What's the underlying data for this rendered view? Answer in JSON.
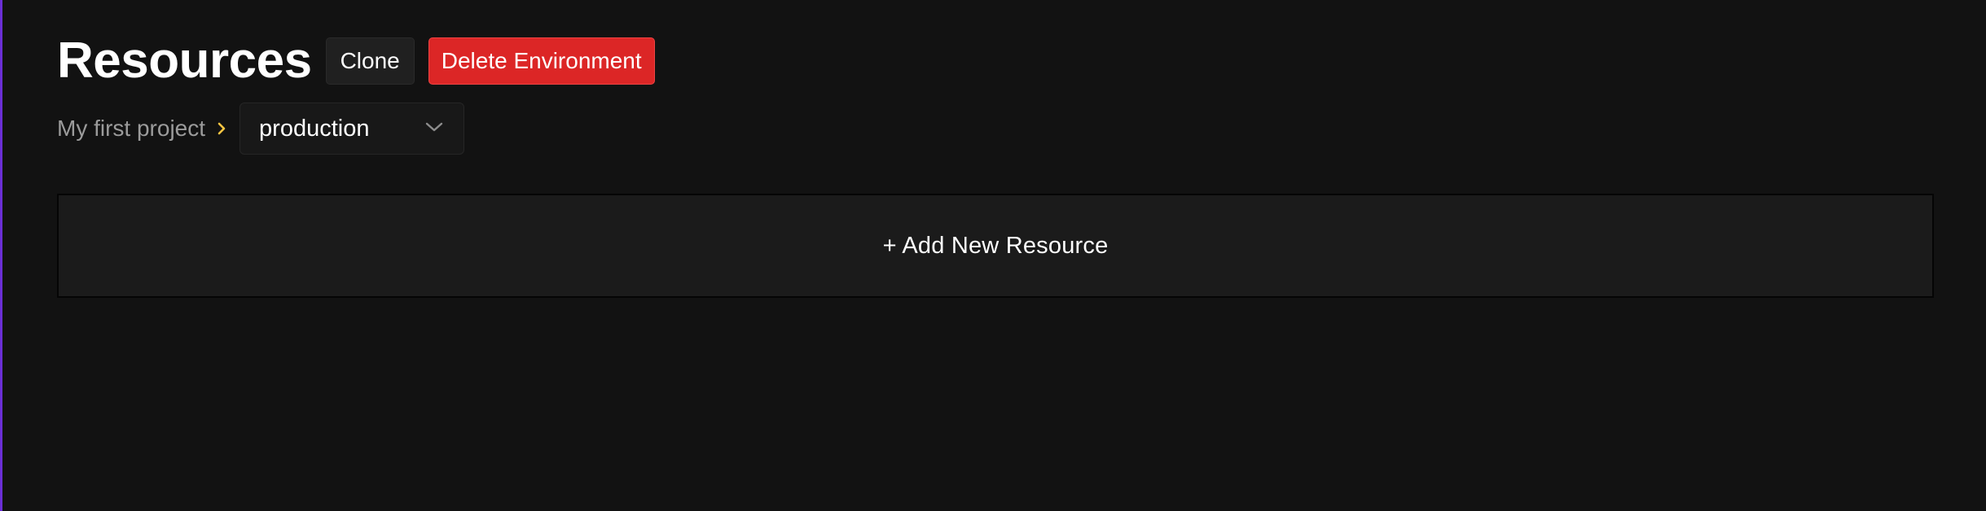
{
  "header": {
    "title": "Resources",
    "clone_label": "Clone",
    "delete_label": "Delete Environment"
  },
  "breadcrumb": {
    "project": "My first project",
    "separator_icon": "chevron-right-icon",
    "environment": "production",
    "dropdown_icon": "chevron-down-icon"
  },
  "main": {
    "add_resource_label": "+ Add New Resource"
  },
  "colors": {
    "background": "#121212",
    "danger": "#dc2626",
    "breadcrumb_chevron": "#f5c542",
    "accent_border": "#6b2fd6"
  }
}
